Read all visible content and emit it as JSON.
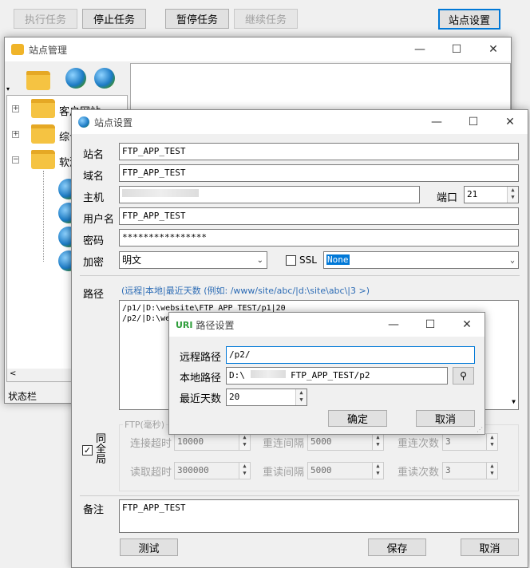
{
  "toolbar": {
    "execute_task": "执行任务",
    "stop_task": "停止任务",
    "pause_task": "暂停任务",
    "resume_task": "继续任务",
    "site_settings": "站点设置"
  },
  "site_manager": {
    "title": "站点管理",
    "tree": [
      "客户网站",
      "综合",
      "软测"
    ],
    "status_bar": "状态栏"
  },
  "site_settings": {
    "title": "站点设置",
    "labels": {
      "site_name": "站名",
      "domain": "域名",
      "host": "主机",
      "port": "端口",
      "username": "用户名",
      "password": "密码",
      "encryption": "加密",
      "ssl": "SSL",
      "path": "路径",
      "ftp_group": "FTP(毫秒)",
      "same_global": "同全局",
      "connect_timeout": "连接超时",
      "reconnect_interval": "重连间隔",
      "reconnect_count": "重连次数",
      "read_timeout": "读取超时",
      "reread_interval": "重读间隔",
      "reread_count": "重读次数",
      "remark": "备注"
    },
    "values": {
      "site_name": "FTP_APP_TEST",
      "domain": "FTP_APP_TEST",
      "host": "",
      "port": "21",
      "username": "FTP_APP_TEST",
      "password": "****************",
      "encryption": "明文",
      "ssl_option": "None",
      "path_hint": "(远程|本地|最近天数 (例如: /www/site/abc/|d:\\site\\abc\\|3 >)",
      "paths": [
        "/p1/|D:\\website\\FTP_APP_TEST/p1|20",
        "/p2/|D:\\we"
      ],
      "connect_timeout": "10000",
      "reconnect_interval": "5000",
      "reconnect_count": "3",
      "read_timeout": "300000",
      "reread_interval": "5000",
      "reread_count": "3",
      "remark": "FTP_APP_TEST"
    },
    "buttons": {
      "test": "测试",
      "save": "保存",
      "cancel": "取消"
    }
  },
  "path_settings": {
    "title": "路径设置",
    "icon_text": "URI",
    "labels": {
      "remote_path": "远程路径",
      "local_path": "本地路径",
      "recent_days": "最近天数"
    },
    "values": {
      "remote_path": "/p2/",
      "local_path_prefix": "D:\\",
      "local_path_suffix": "FTP_APP_TEST/p2",
      "recent_days": "20"
    },
    "buttons": {
      "ok": "确定",
      "cancel": "取消"
    }
  }
}
